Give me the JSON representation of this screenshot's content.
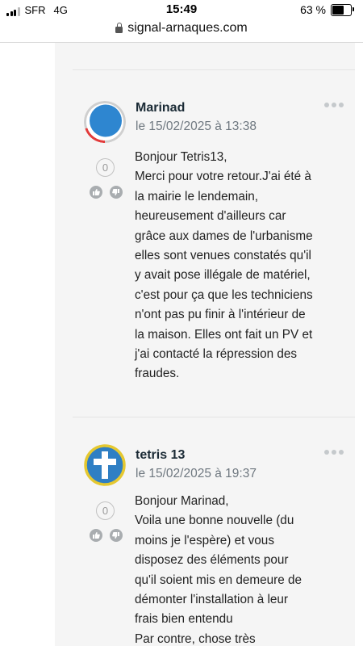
{
  "status_bar": {
    "carrier": "SFR",
    "network": "4G",
    "time": "15:49",
    "battery": "63 %",
    "battery_level": 0.63
  },
  "url_bar": {
    "domain": "signal-arnaques.com"
  },
  "posts": [
    {
      "username": "Marinad",
      "date": "le 15/02/2025 à 13:38",
      "votes": "0",
      "avatar_colors": {
        "fill": "#2e86d0",
        "ring": "#cfcfcf",
        "accent": "#e33a3a"
      },
      "body": [
        "Bonjour Tetris13,",
        "Merci pour votre retour.J'ai été à",
        "la mairie le lendemain,",
        "heureusement d'ailleurs car",
        "grâce aux dames de l'urbanisme",
        "elles sont venues constatés qu'il",
        "y avait pose illégale de matériel,",
        "c'est pour ça que les techniciens",
        "n'ont pas pu finir à l'intérieur de",
        "la maison. Elles ont fait un PV et",
        "j'ai contacté la répression des",
        "fraudes."
      ]
    },
    {
      "username": "tetris 13",
      "date": "le 15/02/2025 à 19:37",
      "votes": "0",
      "avatar_colors": {
        "fill": "#2f7fc4",
        "ring": "#e5c830",
        "cross": "#ffffff"
      },
      "body": [
        "Bonjour Marinad,",
        "Voila une bonne nouvelle (du",
        "moins je l'espère) et vous",
        "disposez des éléments pour",
        "qu'il soient mis en demeure de",
        "démonter l'installation à leur",
        "frais bien entendu",
        "Par contre, chose très"
      ]
    }
  ]
}
